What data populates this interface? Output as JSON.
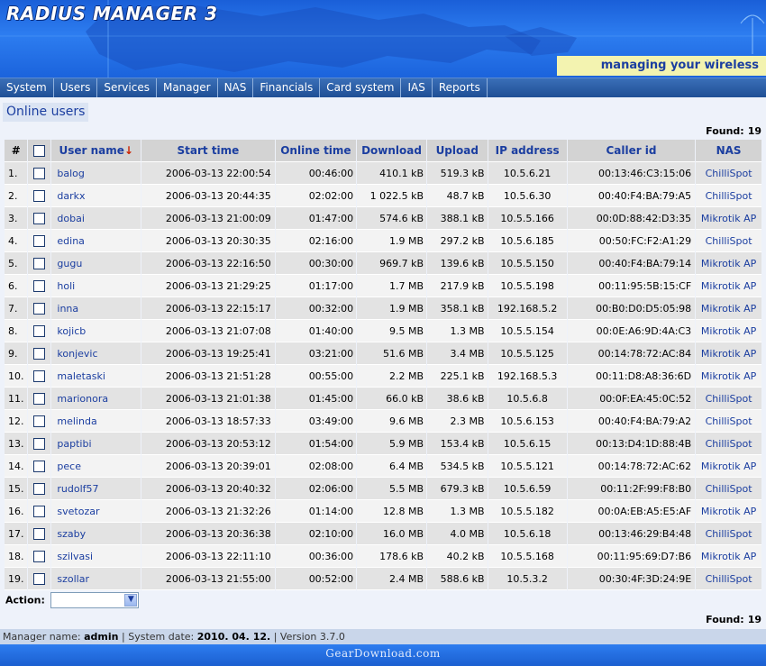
{
  "app": {
    "title": "RADIUS MANAGER 3",
    "tagline": "managing your wireless world..."
  },
  "nav": [
    "System",
    "Users",
    "Services",
    "Manager",
    "NAS",
    "Financials",
    "Card system",
    "IAS",
    "Reports"
  ],
  "section_title": "Online users",
  "found": {
    "label": "Found:",
    "value": "19"
  },
  "table": {
    "headers": {
      "index": "#",
      "user": "User name",
      "start": "Start time",
      "online": "Online time",
      "download": "Download",
      "upload": "Upload",
      "ip": "IP address",
      "caller": "Caller id",
      "nas": "NAS"
    },
    "rows": [
      {
        "idx": "1.",
        "user": "balog",
        "start": "2006-03-13 22:00:54",
        "online": "00:46:00",
        "download": "410.1 kB",
        "upload": "519.3 kB",
        "ip": "10.5.6.21",
        "caller": "00:13:46:C3:15:06",
        "nas": "ChilliSpot"
      },
      {
        "idx": "2.",
        "user": "darkx",
        "start": "2006-03-13 20:44:35",
        "online": "02:02:00",
        "download": "1 022.5 kB",
        "upload": "48.7 kB",
        "ip": "10.5.6.30",
        "caller": "00:40:F4:BA:79:A5",
        "nas": "ChilliSpot"
      },
      {
        "idx": "3.",
        "user": "dobai",
        "start": "2006-03-13 21:00:09",
        "online": "01:47:00",
        "download": "574.6 kB",
        "upload": "388.1 kB",
        "ip": "10.5.5.166",
        "caller": "00:0D:88:42:D3:35",
        "nas": "Mikrotik AP"
      },
      {
        "idx": "4.",
        "user": "edina",
        "start": "2006-03-13 20:30:35",
        "online": "02:16:00",
        "download": "1.9 MB",
        "upload": "297.2 kB",
        "ip": "10.5.6.185",
        "caller": "00:50:FC:F2:A1:29",
        "nas": "ChilliSpot"
      },
      {
        "idx": "5.",
        "user": "gugu",
        "start": "2006-03-13 22:16:50",
        "online": "00:30:00",
        "download": "969.7 kB",
        "upload": "139.6 kB",
        "ip": "10.5.5.150",
        "caller": "00:40:F4:BA:79:14",
        "nas": "Mikrotik AP"
      },
      {
        "idx": "6.",
        "user": "holi",
        "start": "2006-03-13 21:29:25",
        "online": "01:17:00",
        "download": "1.7 MB",
        "upload": "217.9 kB",
        "ip": "10.5.5.198",
        "caller": "00:11:95:5B:15:CF",
        "nas": "Mikrotik AP"
      },
      {
        "idx": "7.",
        "user": "inna",
        "start": "2006-03-13 22:15:17",
        "online": "00:32:00",
        "download": "1.9 MB",
        "upload": "358.1 kB",
        "ip": "192.168.5.2",
        "caller": "00:B0:D0:D5:05:98",
        "nas": "Mikrotik AP"
      },
      {
        "idx": "8.",
        "user": "kojicb",
        "start": "2006-03-13 21:07:08",
        "online": "01:40:00",
        "download": "9.5 MB",
        "upload": "1.3 MB",
        "ip": "10.5.5.154",
        "caller": "00:0E:A6:9D:4A:C3",
        "nas": "Mikrotik AP"
      },
      {
        "idx": "9.",
        "user": "konjevic",
        "start": "2006-03-13 19:25:41",
        "online": "03:21:00",
        "download": "51.6 MB",
        "upload": "3.4 MB",
        "ip": "10.5.5.125",
        "caller": "00:14:78:72:AC:84",
        "nas": "Mikrotik AP"
      },
      {
        "idx": "10.",
        "user": "maletaski",
        "start": "2006-03-13 21:51:28",
        "online": "00:55:00",
        "download": "2.2 MB",
        "upload": "225.1 kB",
        "ip": "192.168.5.3",
        "caller": "00:11:D8:A8:36:6D",
        "nas": "Mikrotik AP"
      },
      {
        "idx": "11.",
        "user": "marionora",
        "start": "2006-03-13 21:01:38",
        "online": "01:45:00",
        "download": "66.0 kB",
        "upload": "38.6 kB",
        "ip": "10.5.6.8",
        "caller": "00:0F:EA:45:0C:52",
        "nas": "ChilliSpot"
      },
      {
        "idx": "12.",
        "user": "melinda",
        "start": "2006-03-13 18:57:33",
        "online": "03:49:00",
        "download": "9.6 MB",
        "upload": "2.3 MB",
        "ip": "10.5.6.153",
        "caller": "00:40:F4:BA:79:A2",
        "nas": "ChilliSpot"
      },
      {
        "idx": "13.",
        "user": "paptibi",
        "start": "2006-03-13 20:53:12",
        "online": "01:54:00",
        "download": "5.9 MB",
        "upload": "153.4 kB",
        "ip": "10.5.6.15",
        "caller": "00:13:D4:1D:88:4B",
        "nas": "ChilliSpot"
      },
      {
        "idx": "14.",
        "user": "pece",
        "start": "2006-03-13 20:39:01",
        "online": "02:08:00",
        "download": "6.4 MB",
        "upload": "534.5 kB",
        "ip": "10.5.5.121",
        "caller": "00:14:78:72:AC:62",
        "nas": "Mikrotik AP"
      },
      {
        "idx": "15.",
        "user": "rudolf57",
        "start": "2006-03-13 20:40:32",
        "online": "02:06:00",
        "download": "5.5 MB",
        "upload": "679.3 kB",
        "ip": "10.5.6.59",
        "caller": "00:11:2F:99:F8:B0",
        "nas": "ChilliSpot"
      },
      {
        "idx": "16.",
        "user": "svetozar",
        "start": "2006-03-13 21:32:26",
        "online": "01:14:00",
        "download": "12.8 MB",
        "upload": "1.3 MB",
        "ip": "10.5.5.182",
        "caller": "00:0A:EB:A5:E5:AF",
        "nas": "Mikrotik AP"
      },
      {
        "idx": "17.",
        "user": "szaby",
        "start": "2006-03-13 20:36:38",
        "online": "02:10:00",
        "download": "16.0 MB",
        "upload": "4.0 MB",
        "ip": "10.5.6.18",
        "caller": "00:13:46:29:B4:48",
        "nas": "ChilliSpot"
      },
      {
        "idx": "18.",
        "user": "szilvasi",
        "start": "2006-03-13 22:11:10",
        "online": "00:36:00",
        "download": "178.6 kB",
        "upload": "40.2 kB",
        "ip": "10.5.5.168",
        "caller": "00:11:95:69:D7:B6",
        "nas": "Mikrotik AP"
      },
      {
        "idx": "19.",
        "user": "szollar",
        "start": "2006-03-13 21:55:00",
        "online": "00:52:00",
        "download": "2.4 MB",
        "upload": "588.6 kB",
        "ip": "10.5.3.2",
        "caller": "00:30:4F:3D:24:9E",
        "nas": "ChilliSpot"
      }
    ]
  },
  "action": {
    "label": "Action:",
    "selected": ""
  },
  "footer": {
    "manager_label": "Manager name:",
    "manager_value": "admin",
    "sep1": "|",
    "date_label": "System date:",
    "date_value": "2010. 04. 12.",
    "sep2": "|",
    "version": "Version 3.7.0"
  },
  "watermark": "GearDownload.com",
  "colors": {
    "banner": "#2d7df0",
    "nav": "#1f4f95",
    "link": "#1b3ea0",
    "tagline_bg": "#f3f3b0"
  }
}
